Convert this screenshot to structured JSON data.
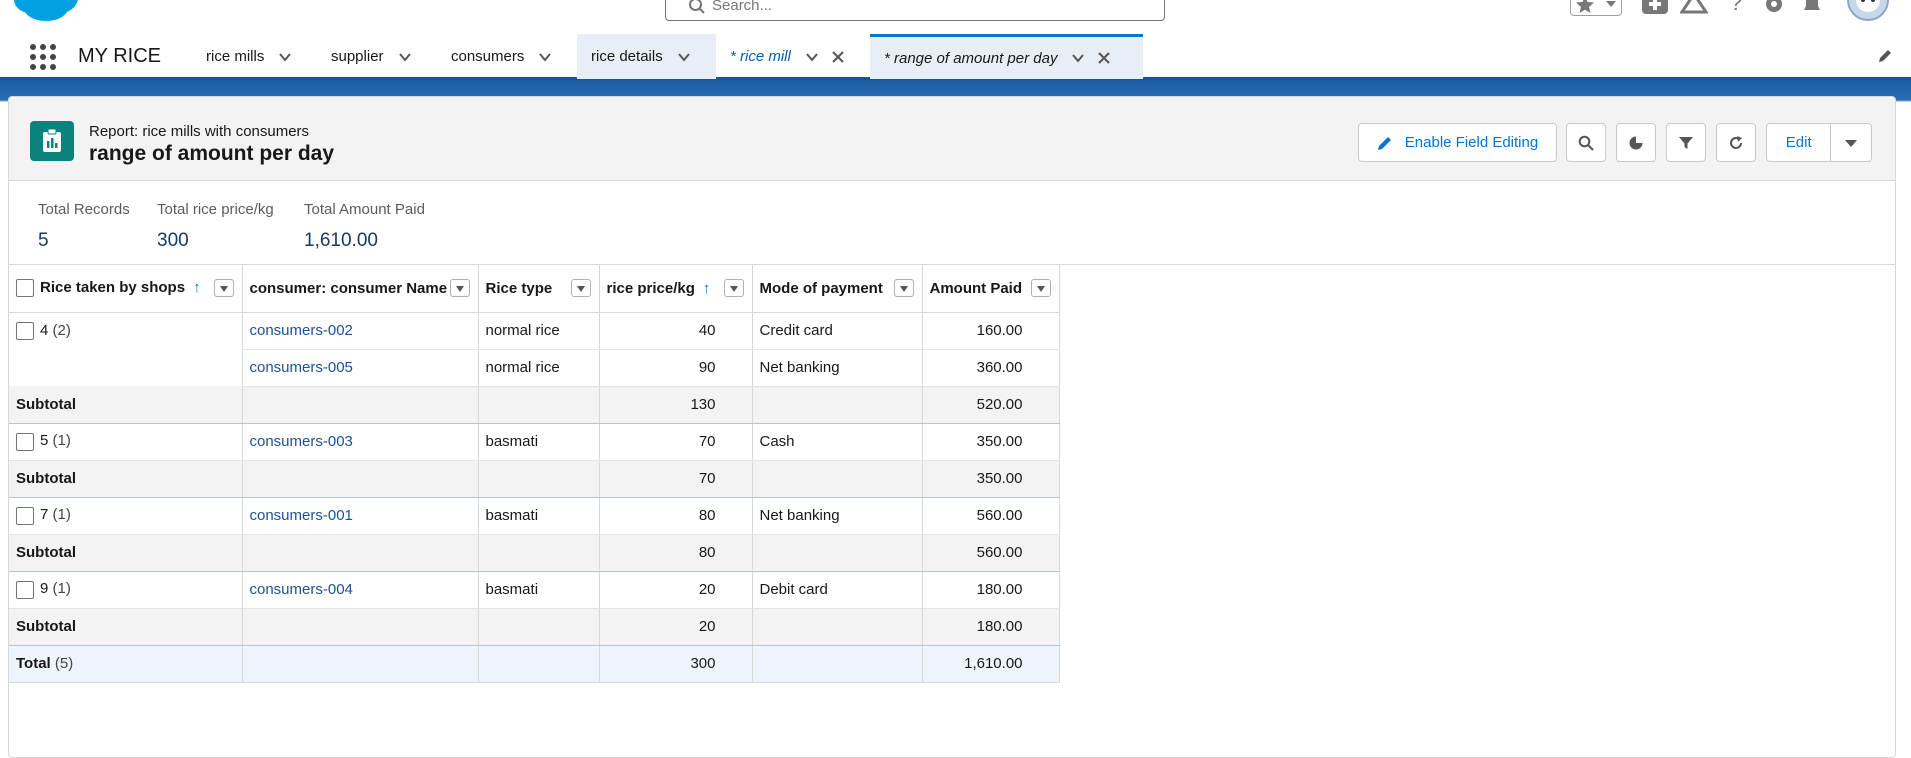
{
  "colors": {
    "brand_blue": "#0176d3",
    "nav_underline": "#1b5297",
    "report_icon": "#0b827c",
    "link": "#1b5297"
  },
  "global_header": {
    "search_placeholder": "Search...",
    "icons": [
      "favorites-star-icon",
      "favorites-dropdown-icon",
      "add-icon",
      "trailhead-icon",
      "help-icon",
      "setup-gear-icon",
      "notifications-bell-icon",
      "avatar-icon"
    ]
  },
  "nav": {
    "app_name": "MY RICE",
    "tabs": [
      {
        "label": "rice mills"
      },
      {
        "label": "supplier"
      },
      {
        "label": "consumers"
      },
      {
        "label": "rice details"
      },
      {
        "label": "* rice mill"
      },
      {
        "label": "* range of amount per day"
      }
    ]
  },
  "report": {
    "type_label": "Report: rice mills with consumers",
    "title": "range of amount per day",
    "buttons": {
      "enable_field_editing": "Enable Field Editing",
      "edit": "Edit"
    },
    "summary": [
      {
        "label": "Total Records",
        "value": "5"
      },
      {
        "label": "Total rice price/kg",
        "value": "300"
      },
      {
        "label": "Total Amount Paid",
        "value": "1,610.00"
      }
    ],
    "columns": [
      "Rice taken by shops",
      "consumer: consumer Name",
      "Rice type",
      "rice price/kg",
      "Mode of payment",
      "Amount Paid"
    ],
    "groups": [
      {
        "key": "4",
        "count": "(2)",
        "rows": [
          {
            "name": "consumers-002",
            "type": "normal rice",
            "price": "40",
            "mode": "Credit card",
            "amount": "160.00"
          },
          {
            "name": "consumers-005",
            "type": "normal rice",
            "price": "90",
            "mode": "Net banking",
            "amount": "360.00"
          }
        ],
        "subtotal_label": "Subtotal",
        "subtotal_price": "130",
        "subtotal_amount": "520.00"
      },
      {
        "key": "5",
        "count": "(1)",
        "rows": [
          {
            "name": "consumers-003",
            "type": "basmati",
            "price": "70",
            "mode": "Cash",
            "amount": "350.00"
          }
        ],
        "subtotal_label": "Subtotal",
        "subtotal_price": "70",
        "subtotal_amount": "350.00"
      },
      {
        "key": "7",
        "count": "(1)",
        "rows": [
          {
            "name": "consumers-001",
            "type": "basmati",
            "price": "80",
            "mode": "Net banking",
            "amount": "560.00"
          }
        ],
        "subtotal_label": "Subtotal",
        "subtotal_price": "80",
        "subtotal_amount": "560.00"
      },
      {
        "key": "9",
        "count": "(1)",
        "rows": [
          {
            "name": "consumers-004",
            "type": "basmati",
            "price": "20",
            "mode": "Debit card",
            "amount": "180.00"
          }
        ],
        "subtotal_label": "Subtotal",
        "subtotal_price": "20",
        "subtotal_amount": "180.00"
      }
    ],
    "total": {
      "label": "Total",
      "count": "(5)",
      "price": "300",
      "amount": "1,610.00"
    }
  }
}
